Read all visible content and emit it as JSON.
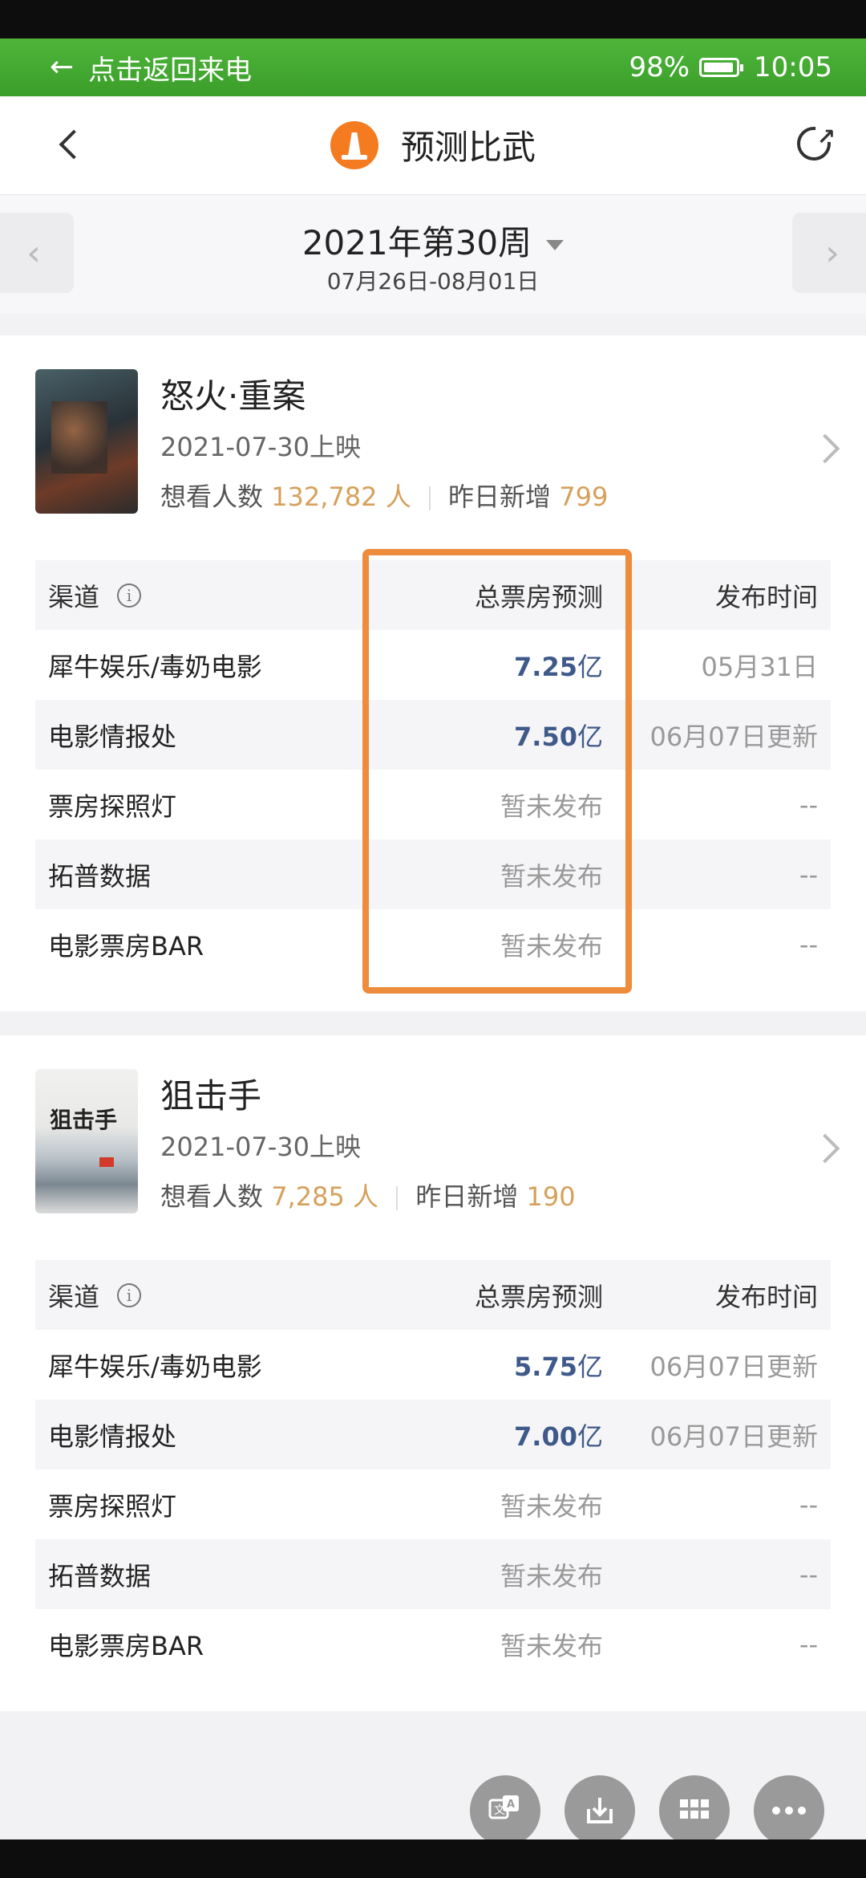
{
  "status_bar": {
    "call_text": "点击返回来电",
    "battery": "98%",
    "time": "10:05"
  },
  "header": {
    "title": "预测比武"
  },
  "week": {
    "title": "2021年第30周",
    "range": "07月26日-08月01日"
  },
  "table_headers": {
    "channel": "渠道",
    "forecast": "总票房预测",
    "published": "发布时间"
  },
  "colors": {
    "accent_orange": "#ec8c3c",
    "value_blue": "#3f5a8a",
    "highlight_number": "#d6a05a",
    "callbar_green": "#3a9e2a"
  },
  "movies": [
    {
      "title": "怒火·重案",
      "release": "2021-07-30上映",
      "want_label": "想看人数",
      "want_count": "132,782",
      "want_unit": "人",
      "new_label": "昨日新增",
      "new_count": "799",
      "rows": [
        {
          "channel": "犀牛娱乐/毒奶电影",
          "value": "7.25",
          "unit": "亿",
          "published": "05月31日"
        },
        {
          "channel": "电影情报处",
          "value": "7.50",
          "unit": "亿",
          "published": "06月07日更新"
        },
        {
          "channel": "票房探照灯",
          "pending": "暂未发布",
          "published": "--"
        },
        {
          "channel": "拓普数据",
          "pending": "暂未发布",
          "published": "--"
        },
        {
          "channel": "电影票房BAR",
          "pending": "暂未发布",
          "published": "--"
        }
      ]
    },
    {
      "title": "狙击手",
      "release": "2021-07-30上映",
      "want_label": "想看人数",
      "want_count": "7,285",
      "want_unit": "人",
      "new_label": "昨日新增",
      "new_count": "190",
      "rows": [
        {
          "channel": "犀牛娱乐/毒奶电影",
          "value": "5.75",
          "unit": "亿",
          "published": "06月07日更新"
        },
        {
          "channel": "电影情报处",
          "value": "7.00",
          "unit": "亿",
          "published": "06月07日更新"
        },
        {
          "channel": "票房探照灯",
          "pending": "暂未发布",
          "published": "--"
        },
        {
          "channel": "拓普数据",
          "pending": "暂未发布",
          "published": "--"
        },
        {
          "channel": "电影票房BAR",
          "pending": "暂未发布",
          "published": "--"
        }
      ]
    }
  ],
  "fabs": [
    "translate-icon",
    "download-icon",
    "grid-icon",
    "more-icon"
  ]
}
